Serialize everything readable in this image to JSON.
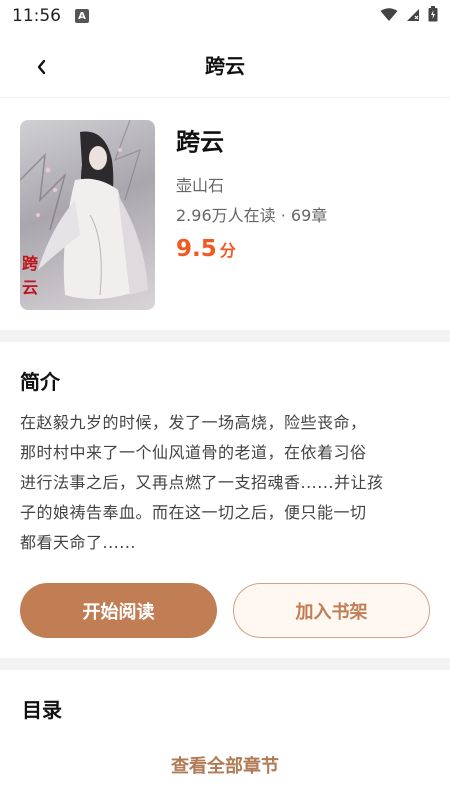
{
  "status_bar": {
    "time": "11:56",
    "notification_icon": "A",
    "icons": [
      "wifi-icon",
      "signal-icon",
      "battery-icon"
    ]
  },
  "nav": {
    "title": "跨云",
    "back_icon": "chevron-left-icon"
  },
  "book": {
    "title": "跨云",
    "author": "壶山石",
    "meta": "2.96万人在读 · 69章",
    "rating_value": "9.5",
    "rating_unit": "分",
    "cover_text": "跨云"
  },
  "intro": {
    "heading": "简介",
    "lines": [
      "在赵毅九岁的时候，发了一场高烧，险些丧命，",
      "那时村中来了一个仙风道骨的老道，在依着习俗",
      "进行法事之后，又再点燃了一支招魂香......并让孩",
      "子的娘祷告奉血。而在这一切之后，便只能一切",
      "都看天命了......"
    ]
  },
  "actions": {
    "start_reading": "开始阅读",
    "add_to_shelf": "加入书架"
  },
  "toc": {
    "heading": "目录",
    "view_all": "查看全部章节"
  },
  "colors": {
    "accent": "#c17e54",
    "rating": "#f05a22",
    "shelf_bg": "#fff7f2"
  }
}
